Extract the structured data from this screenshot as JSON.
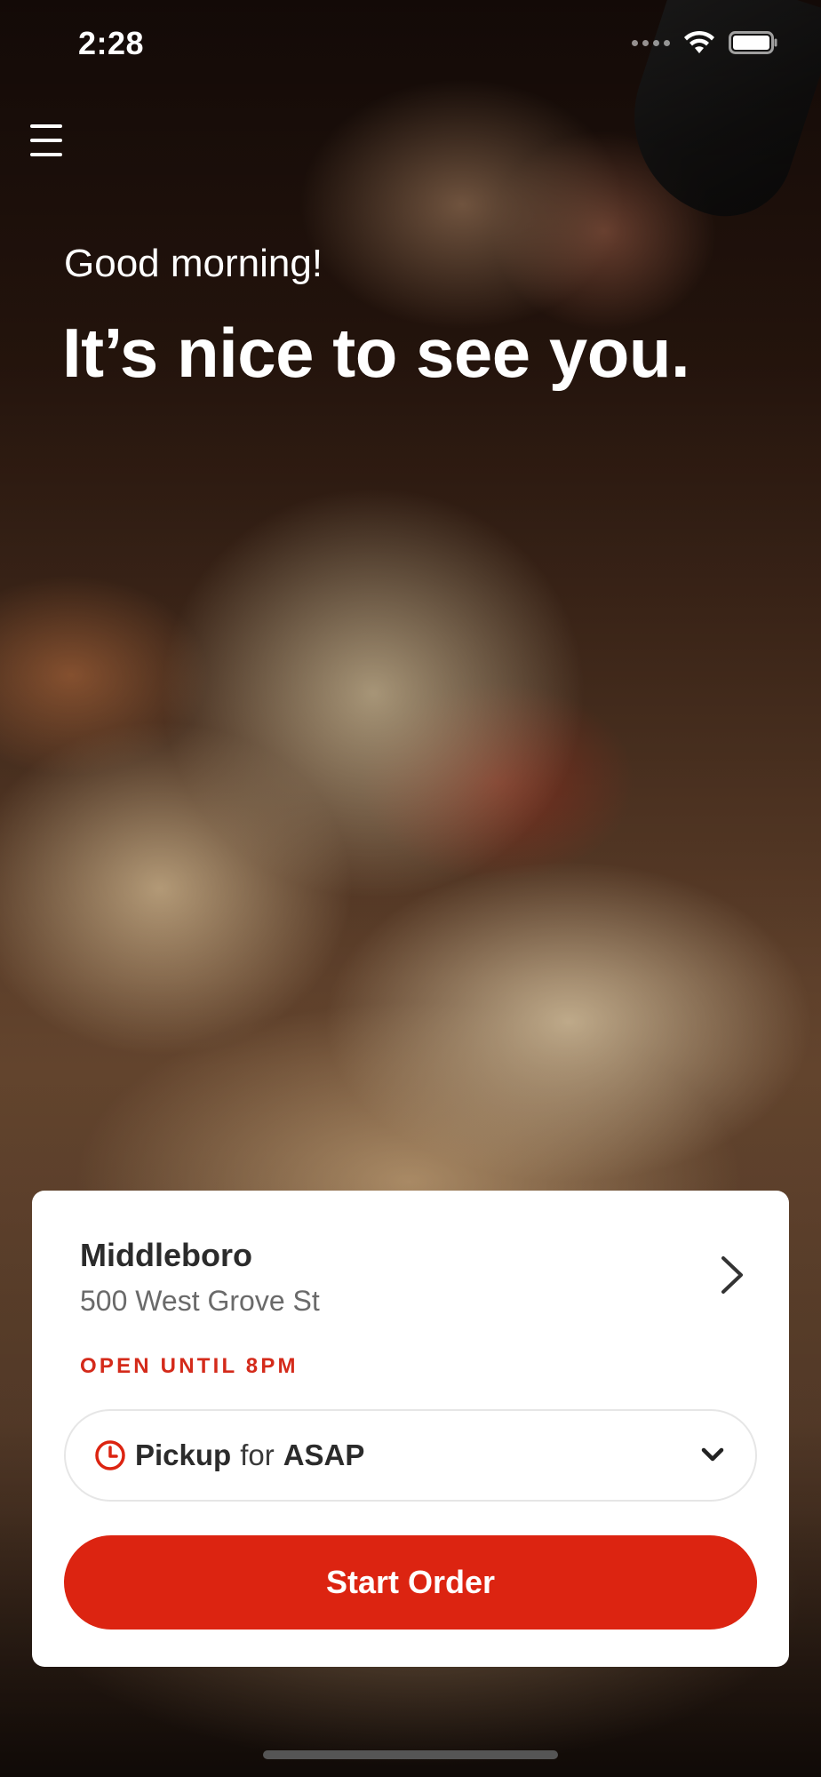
{
  "status_bar": {
    "time": "2:28",
    "icons": [
      "signal-icon",
      "wifi-icon",
      "battery-icon"
    ]
  },
  "header": {
    "menu_icon": "hamburger-menu-icon"
  },
  "hero": {
    "greeting": "Good morning!",
    "headline": "It’s nice to see you."
  },
  "store": {
    "name": "Middleboro",
    "address": "500 West Grove St",
    "status": "OPEN UNTIL 8PM"
  },
  "order_type": {
    "mode": "Pickup",
    "connector": "for",
    "time": "ASAP"
  },
  "actions": {
    "start_order": "Start Order"
  },
  "colors": {
    "accent": "#dc2411",
    "status_text": "#d42a1a",
    "card_bg": "#ffffff"
  }
}
